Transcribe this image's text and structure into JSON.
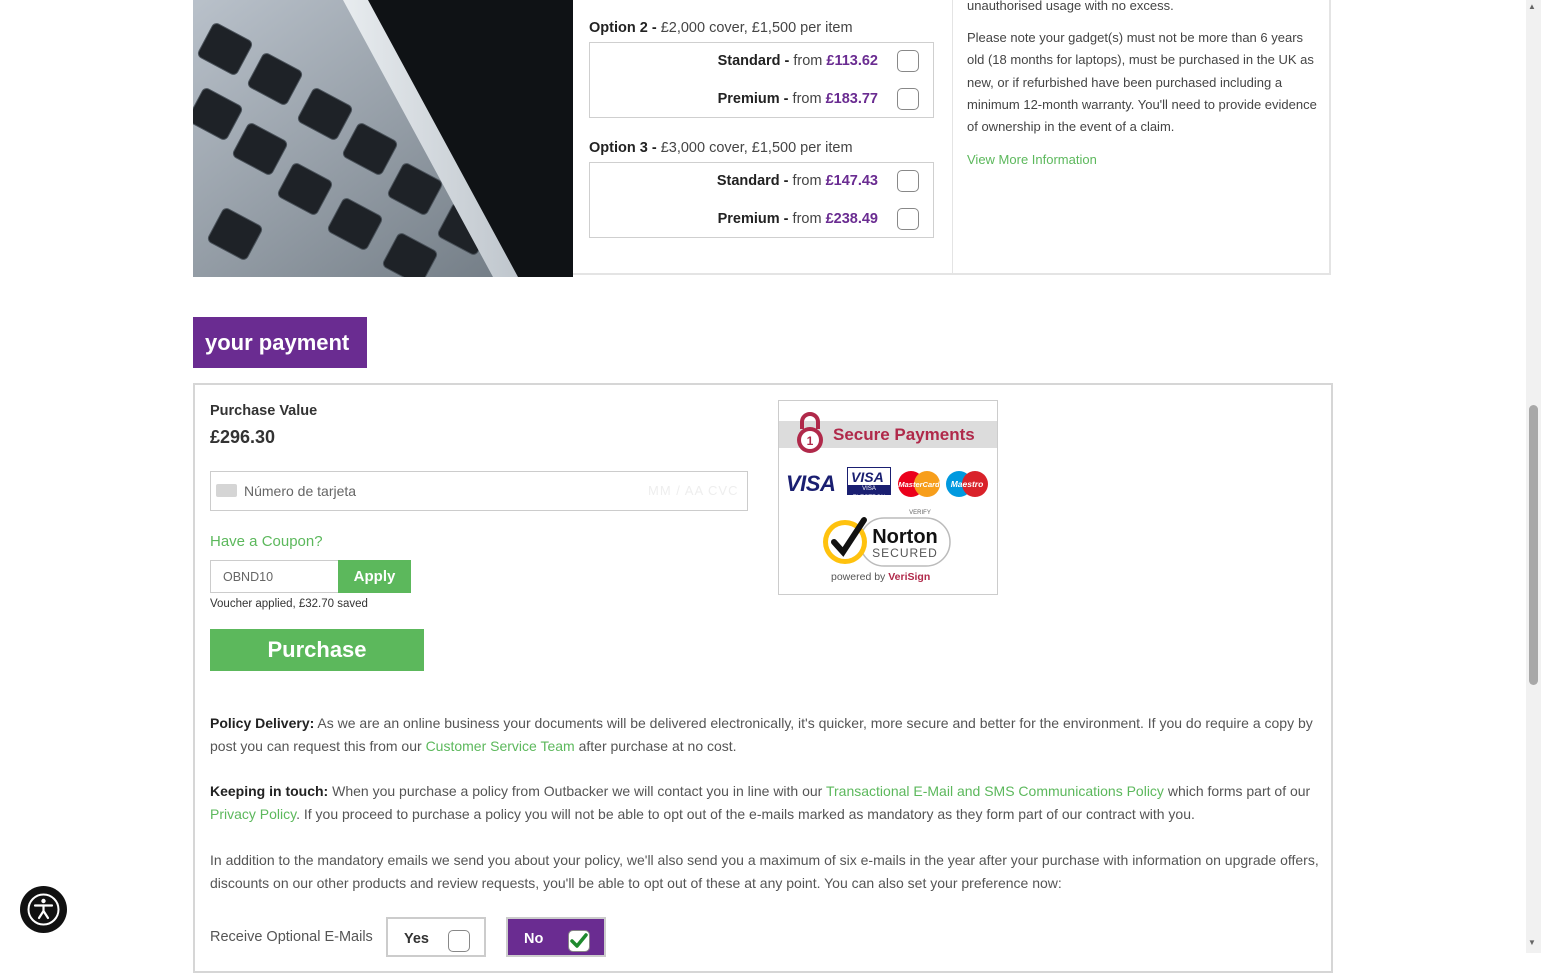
{
  "options": [
    {
      "heading_bold": "Option 2 -",
      "heading_detail": "£2,000 cover, £1,500 per item",
      "standard": {
        "label": "Standard -",
        "from": "from",
        "price": "£113.62",
        "checked": false
      },
      "premium": {
        "label": "Premium -",
        "from": "from",
        "price": "£183.77",
        "checked": false
      }
    },
    {
      "heading_bold": "Option 3 -",
      "heading_detail": "£3,000 cover, £1,500 per item",
      "standard": {
        "label": "Standard -",
        "from": "from",
        "price": "£147.43",
        "checked": false
      },
      "premium": {
        "label": "Premium -",
        "from": "from",
        "price": "£238.49",
        "checked": false
      }
    }
  ],
  "info": {
    "excess_line": "unauthorised usage with no excess.",
    "note": "Please note your gadget(s) must not be more than 6 years old (18 months for laptops), must be purchased in the UK as new, or if refurbished have been purchased including a minimum 12-month warranty. You'll need to provide evidence of ownership in the event of a claim.",
    "more_link": "View More Information"
  },
  "payment": {
    "heading": "your payment",
    "purchase_value_label": "Purchase Value",
    "purchase_value": "£296.30",
    "card_placeholder": "Número de tarjeta",
    "card_ghost": "MM / AA  CVC",
    "coupon_link": "Have a Coupon?",
    "coupon_value": "OBND10",
    "apply_label": "Apply",
    "voucher_status": "Voucher applied, £32.70 saved",
    "purchase_label": "Purchase"
  },
  "secure": {
    "title": "Secure Payments",
    "card_brands": [
      "VISA",
      "VISA ELECTRON",
      "MasterCard",
      "Maestro"
    ],
    "norton": {
      "verify": "VERIFY",
      "name": "Norton",
      "secured": "SECURED",
      "powered": "powered by",
      "verisign": "VeriSign"
    }
  },
  "policy_delivery": {
    "label": "Policy Delivery:",
    "text_1": " As we are an online business your documents will be delivered electronically, it's quicker, more secure and better for the environment. If you do require a copy by post you can request this from our ",
    "link": "Customer Service Team",
    "text_2": " after purchase at no cost."
  },
  "keeping_in_touch": {
    "label": "Keeping in touch:",
    "text_1": " When you purchase a policy from Outbacker we will contact you in line with our ",
    "link_1": "Transactional E-Mail and SMS Communications Policy",
    "text_2": " which forms part of our ",
    "link_2": "Privacy Policy",
    "text_3": ". If you proceed to purchase a policy you will not be able to opt out of the e-mails marked as mandatory as they form part of our contract with you."
  },
  "optional_emails_text": "In addition to the mandatory emails we send you about your policy, we'll also send you a maximum of six e-mails in the year after your purchase with information on upgrade offers, discounts on our other products and review requests, you'll be able to opt out of these at any point. You can also set your preference now:",
  "optional_emails": {
    "label": "Receive Optional E-Mails",
    "yes": {
      "label": "Yes",
      "checked": false
    },
    "no": {
      "label": "No",
      "checked": true
    }
  },
  "colors": {
    "brand_purple": "#6a2c91",
    "accent_green": "#5cb85c",
    "secure_red": "#b0294a"
  }
}
